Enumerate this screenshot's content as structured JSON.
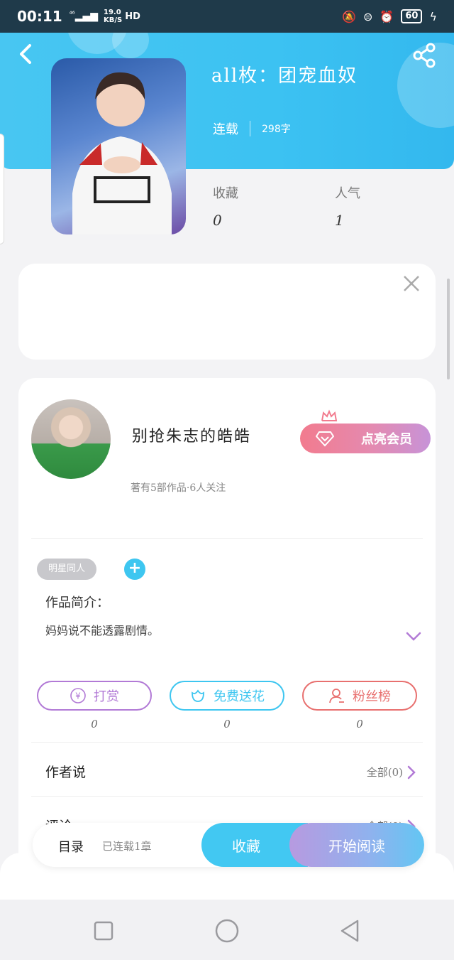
{
  "status_bar": {
    "time": "00:11",
    "network_top": "⁴⁶",
    "speed_value": "19.0",
    "speed_unit": "KB/S",
    "hd": "HD",
    "battery": "60"
  },
  "book": {
    "title": "all枚：团宠血奴",
    "status": "连载",
    "word_count": "298字",
    "stats": [
      {
        "label": "收藏",
        "value": "0"
      },
      {
        "label": "人气",
        "value": "1"
      }
    ]
  },
  "author": {
    "name": "别抢朱志的皓皓",
    "meta": "著有5部作品·6人关注",
    "vip_button": "点亮会员"
  },
  "tags": {
    "items": [
      "明星同人"
    ],
    "add": "+"
  },
  "intro": {
    "label": "作品简介：",
    "text": "妈妈说不能透露剧情。"
  },
  "actions": [
    {
      "label": "打赏",
      "count": "0",
      "color": "#b27ad6",
      "icon": "yen-icon"
    },
    {
      "label": "免费送花",
      "count": "0",
      "color": "#3ec6f0",
      "icon": "flower-icon"
    },
    {
      "label": "粉丝榜",
      "count": "0",
      "color": "#e8706f",
      "icon": "fan-rank-icon"
    }
  ],
  "author_says": {
    "label": "作者说",
    "right": "全部(0)"
  },
  "comments": {
    "label": "评论",
    "right": "全部(0)"
  },
  "bottom_bar": {
    "toc": "目录",
    "toc_sub": "已连载1章",
    "favorite": "收藏",
    "read": "开始阅读"
  },
  "colors": {
    "header": "#3cc2f2",
    "accent": "#42c8f2",
    "vip_start": "#f27b8e",
    "vip_end": "#c793d8"
  }
}
